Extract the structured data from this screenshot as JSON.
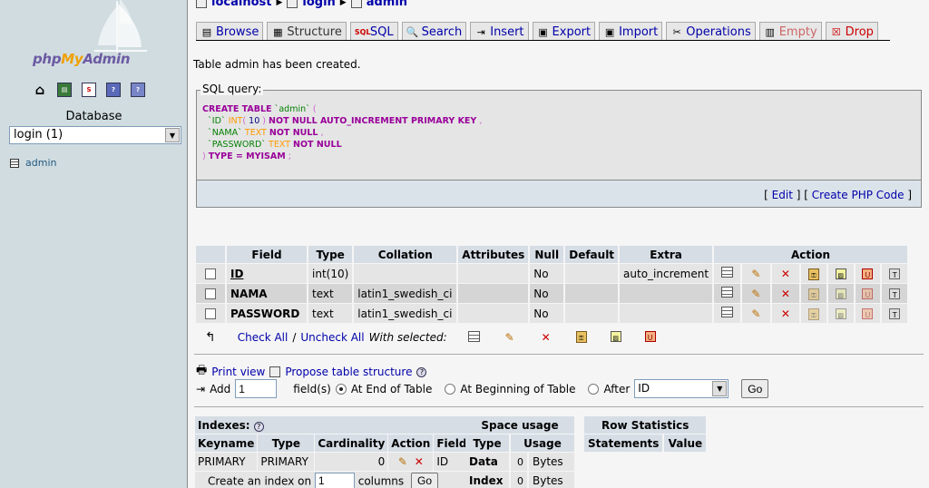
{
  "sidebar": {
    "logo": {
      "php": "php",
      "my": "My",
      "admin": "Admin"
    },
    "nav_icons": [
      "home-icon",
      "query-window-icon",
      "sql-docs-icon",
      "phpmyadmin-docs-icon",
      "mysql-docs-icon"
    ],
    "database_label": "Database",
    "database_selected": "login (1)",
    "tables": [
      {
        "name": "admin"
      }
    ]
  },
  "breadcrumb": {
    "server": "localhost",
    "database": "login",
    "table": "admin"
  },
  "tabs": [
    {
      "label": "Browse",
      "icon": "browse-icon"
    },
    {
      "label": "Structure",
      "icon": "structure-icon"
    },
    {
      "label": "SQL",
      "icon": "sql-icon"
    },
    {
      "label": "Search",
      "icon": "search-icon"
    },
    {
      "label": "Insert",
      "icon": "insert-icon"
    },
    {
      "label": "Export",
      "icon": "export-icon"
    },
    {
      "label": "Import",
      "icon": "import-icon"
    },
    {
      "label": "Operations",
      "icon": "operations-icon"
    },
    {
      "label": "Empty",
      "icon": "empty-icon"
    },
    {
      "label": "Drop",
      "icon": "drop-icon"
    }
  ],
  "message": "Table admin has been created.",
  "sql_query": {
    "legend": "SQL query:",
    "line1": {
      "kw": "CREATE TABLE",
      "name": "`admin`",
      "paren": "("
    },
    "line2": {
      "name": "`ID`",
      "type": "INT",
      "open": "(",
      "num": "10",
      "close": ")",
      "rest": "NOT NULL AUTO_INCREMENT PRIMARY KEY",
      "comma": ","
    },
    "line3": {
      "name": "`NAMA`",
      "type": "TEXT",
      "rest": "NOT NULL",
      "comma": ","
    },
    "line4": {
      "name": "`PASSWORD`",
      "type": "TEXT",
      "rest": "NOT NULL"
    },
    "line5": {
      "paren": ")",
      "rest": "TYPE = MYISAM",
      "semi": ";"
    },
    "links": {
      "open": "[",
      "edit": "Edit",
      "mid": "] [",
      "php": "Create PHP Code",
      "close": "]"
    }
  },
  "structure": {
    "headers": [
      "Field",
      "Type",
      "Collation",
      "Attributes",
      "Null",
      "Default",
      "Extra",
      "Action"
    ],
    "rows": [
      {
        "field": "ID",
        "type": "int(10)",
        "collation": "",
        "attributes": "",
        "null": "No",
        "default": "",
        "extra": "auto_increment"
      },
      {
        "field": "NAMA",
        "type": "text",
        "collation": "latin1_swedish_ci",
        "attributes": "",
        "null": "No",
        "default": "",
        "extra": ""
      },
      {
        "field": "PASSWORD",
        "type": "text",
        "collation": "latin1_swedish_ci",
        "attributes": "",
        "null": "No",
        "default": "",
        "extra": ""
      }
    ],
    "check_all": "Check All",
    "separator": "/",
    "uncheck_all": "Uncheck All",
    "with_selected": "With selected:"
  },
  "tools": {
    "print_view": "Print view",
    "propose": "Propose table structure",
    "add_label": "Add",
    "add_count": "1",
    "fields_label": "field(s)",
    "at_end": "At End of Table",
    "at_beginning": "At Beginning of Table",
    "after": "After",
    "after_selected": "ID",
    "go": "Go"
  },
  "indexes": {
    "title": "Indexes:",
    "headers": [
      "Keyname",
      "Type",
      "Cardinality",
      "Action",
      "Field"
    ],
    "rows": [
      {
        "keyname": "PRIMARY",
        "type": "PRIMARY",
        "cardinality": "0",
        "field": "ID"
      }
    ],
    "create_label": "Create an index on",
    "create_count": "1",
    "columns_label": "columns",
    "go": "Go"
  },
  "space_usage": {
    "title": "Space usage",
    "headers": [
      "Type",
      "Usage"
    ],
    "rows": [
      {
        "type": "Data",
        "value": "0",
        "unit": "Bytes"
      },
      {
        "type": "Index",
        "value": "0",
        "unit": "Bytes"
      }
    ]
  },
  "row_statistics": {
    "title": "Row Statistics",
    "headers": [
      "Statements",
      "Value"
    ]
  },
  "colors": {
    "link": "#0000aa",
    "header_bg": "#d6dde5",
    "left_bg": "#d0dce0",
    "danger": "#cc0000"
  }
}
